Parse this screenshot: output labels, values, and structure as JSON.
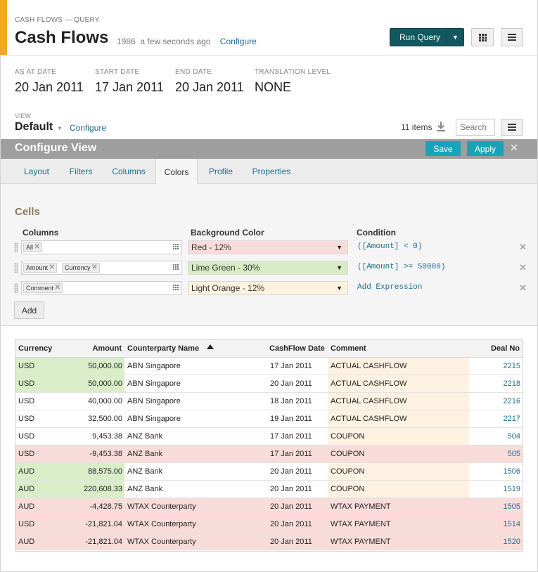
{
  "header": {
    "breadcrumb": "CASH FLOWS — QUERY",
    "title": "Cash Flows",
    "count": "1986",
    "updated": "a few seconds ago",
    "configure_label": "Configure",
    "run_query_label": "Run Query",
    "accent_color": "#f5a623"
  },
  "params": [
    {
      "label": "AS AT DATE",
      "value": "20 Jan 2011"
    },
    {
      "label": "START DATE",
      "value": "17 Jan 2011"
    },
    {
      "label": "END DATE",
      "value": "20 Jan 2011"
    },
    {
      "label": "TRANSLATION LEVEL",
      "value": "NONE"
    }
  ],
  "view": {
    "label": "VIEW",
    "name": "Default",
    "configure_label": "Configure",
    "items_count": "11 items",
    "search_placeholder": "Search"
  },
  "configure_view": {
    "title": "Configure View",
    "save_label": "Save",
    "apply_label": "Apply",
    "tabs": [
      "Layout",
      "Filters",
      "Columns",
      "Colors",
      "Profile",
      "Properties"
    ],
    "active_tab": "Colors",
    "cells_heading": "Cells",
    "col_headers": {
      "columns": "Columns",
      "background": "Background Color",
      "condition": "Condition"
    },
    "rules": [
      {
        "tags": [
          "All"
        ],
        "background": "Red - 12%",
        "bg_color": "#f8dcda",
        "condition": "([Amount] < 0)"
      },
      {
        "tags": [
          "Amount",
          "Currency"
        ],
        "background": "Lime Green - 30%",
        "bg_color": "#d7ecc4",
        "condition": "([Amount] >= 50000)"
      },
      {
        "tags": [
          "Comment"
        ],
        "background": "Light Orange - 12%",
        "bg_color": "#fdf1e0",
        "condition": "Add Expression"
      }
    ],
    "add_label": "Add"
  },
  "table": {
    "headers": [
      "Currency",
      "Amount",
      "Counterparty Name",
      "CashFlow Date",
      "Comment",
      "Deal No"
    ],
    "colors": {
      "red": "#f8dcda",
      "green": "#d9edc8",
      "orange": "#fdf2e1"
    },
    "rows": [
      {
        "currency": "USD",
        "amount": "50,000.00",
        "counterparty": "ABN Singapore",
        "date": "17 Jan 2011",
        "comment": "ACTUAL CASHFLOW",
        "deal": "2215",
        "bg": "green"
      },
      {
        "currency": "USD",
        "amount": "50,000.00",
        "counterparty": "ABN Singapore",
        "date": "20 Jan 2011",
        "comment": "ACTUAL CASHFLOW",
        "deal": "2218",
        "bg": "green"
      },
      {
        "currency": "USD",
        "amount": "40,000.00",
        "counterparty": "ABN Singapore",
        "date": "18 Jan 2011",
        "comment": "ACTUAL CASHFLOW",
        "deal": "2216",
        "bg": "none"
      },
      {
        "currency": "USD",
        "amount": "32,500.00",
        "counterparty": "ABN Singapore",
        "date": "19 Jan 2011",
        "comment": "ACTUAL CASHFLOW",
        "deal": "2217",
        "bg": "none"
      },
      {
        "currency": "USD",
        "amount": "9,453.38",
        "counterparty": "ANZ Bank",
        "date": "17 Jan 2011",
        "comment": "COUPON",
        "deal": "504",
        "bg": "none"
      },
      {
        "currency": "USD",
        "amount": "-9,453.38",
        "counterparty": "ANZ Bank",
        "date": "17 Jan 2011",
        "comment": "COUPON",
        "deal": "505",
        "bg": "red"
      },
      {
        "currency": "AUD",
        "amount": "88,575.00",
        "counterparty": "ANZ Bank",
        "date": "20 Jan 2011",
        "comment": "COUPON",
        "deal": "1506",
        "bg": "green"
      },
      {
        "currency": "AUD",
        "amount": "220,608.33",
        "counterparty": "ANZ Bank",
        "date": "20 Jan 2011",
        "comment": "COUPON",
        "deal": "1519",
        "bg": "green"
      },
      {
        "currency": "AUD",
        "amount": "-4,428.75",
        "counterparty": "WTAX Counterparty",
        "date": "20 Jan 2011",
        "comment": "WTAX PAYMENT",
        "deal": "1505",
        "bg": "red"
      },
      {
        "currency": "USD",
        "amount": "-21,821.04",
        "counterparty": "WTAX Counterparty",
        "date": "20 Jan 2011",
        "comment": "WTAX PAYMENT",
        "deal": "1514",
        "bg": "red"
      },
      {
        "currency": "AUD",
        "amount": "-21,821.04",
        "counterparty": "WTAX Counterparty",
        "date": "20 Jan 2011",
        "comment": "WTAX PAYMENT",
        "deal": "1520",
        "bg": "red"
      }
    ]
  }
}
